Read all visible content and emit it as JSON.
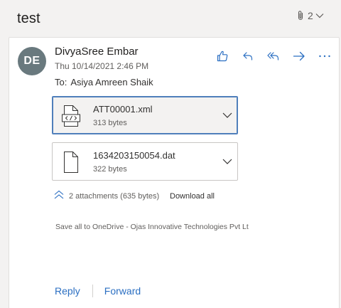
{
  "conversation": {
    "subject": "test",
    "attachment_count": "2"
  },
  "message": {
    "avatar_initials": "DE",
    "sender": "DivyaSree Embar",
    "date": "Thu 10/14/2021 2:46 PM",
    "to_label": "To:",
    "to_recipient": "Asiya Amreen Shaik",
    "actions": [
      "like-icon",
      "reply-icon",
      "reply-all-icon",
      "forward-icon",
      "more-options-icon"
    ]
  },
  "attachments": [
    {
      "name": "ATT00001.xml",
      "size": "313 bytes",
      "icon": "code-file-icon",
      "selected": true
    },
    {
      "name": "1634203150054.dat",
      "size": "322 bytes",
      "icon": "generic-file-icon",
      "selected": false
    }
  ],
  "attachments_summary": {
    "text": "2 attachments (635 bytes)",
    "download_all": "Download all",
    "save_to_onedrive": "Save all to OneDrive - Ojas Innovative Technologies Pvt Lt"
  },
  "footer": {
    "reply": "Reply",
    "forward": "Forward"
  },
  "colors": {
    "accent": "#2b6fc2",
    "avatar_bg": "#69797e",
    "selected_border": "#4f7fbb"
  }
}
